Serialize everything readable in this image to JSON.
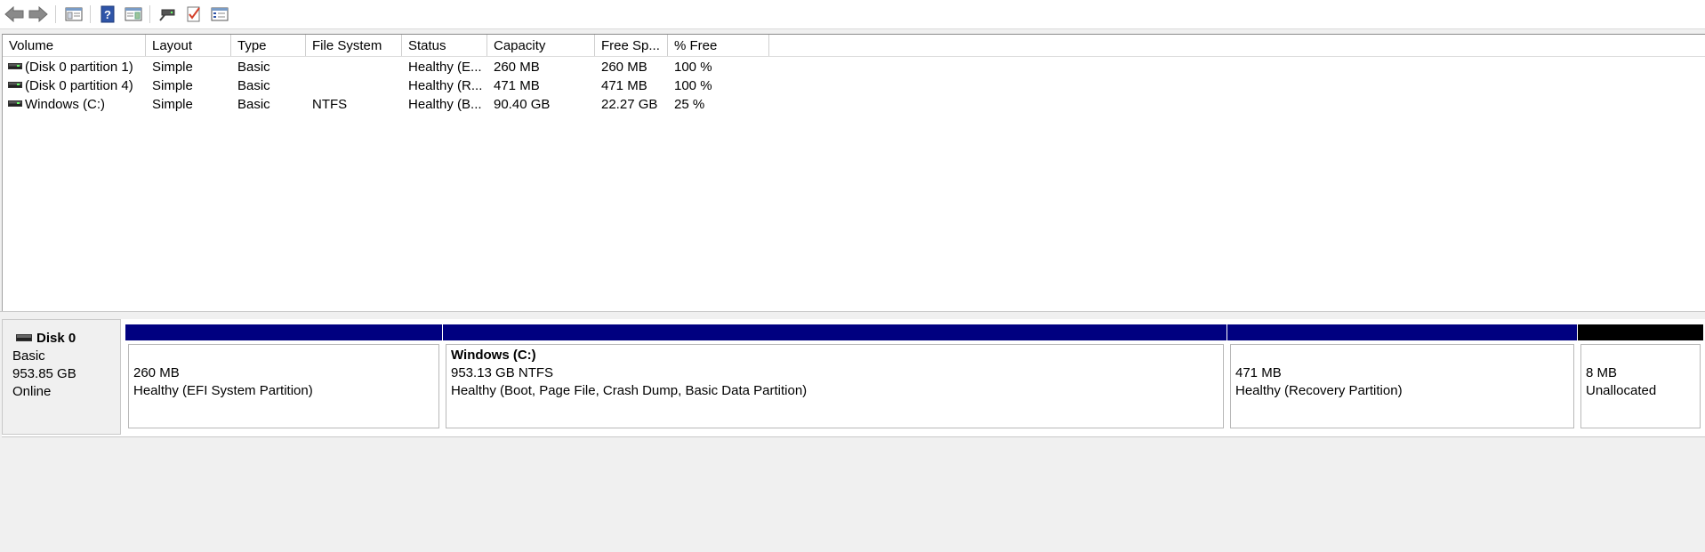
{
  "toolbar": {
    "buttons": [
      {
        "name": "back-arrow-icon"
      },
      {
        "name": "forward-arrow-icon"
      },
      {
        "name": "show-hide-console-tree-icon"
      },
      {
        "name": "help-icon"
      },
      {
        "name": "show-hide-action-pane-icon"
      },
      {
        "name": "connect-disk-icon"
      },
      {
        "name": "checklist-icon"
      },
      {
        "name": "properties-icon"
      }
    ]
  },
  "volume_list": {
    "columns": [
      "Volume",
      "Layout",
      "Type",
      "File System",
      "Status",
      "Capacity",
      "Free Sp...",
      "% Free"
    ],
    "rows": [
      {
        "volume": "(Disk 0 partition 1)",
        "layout": "Simple",
        "type": "Basic",
        "file_system": "",
        "status": "Healthy (E...",
        "capacity": "260 MB",
        "free_space": "260 MB",
        "percent_free": "100 %"
      },
      {
        "volume": "(Disk 0 partition 4)",
        "layout": "Simple",
        "type": "Basic",
        "file_system": "",
        "status": "Healthy (R...",
        "capacity": "471 MB",
        "free_space": "471 MB",
        "percent_free": "100 %"
      },
      {
        "volume": "Windows (C:)",
        "layout": "Simple",
        "type": "Basic",
        "file_system": "NTFS",
        "status": "Healthy (B...",
        "capacity": "90.40 GB",
        "free_space": "22.27 GB",
        "percent_free": "25 %"
      }
    ]
  },
  "disk": {
    "name": "Disk 0",
    "type": "Basic",
    "size": "953.85 GB",
    "status": "Online",
    "partitions": [
      {
        "title": "",
        "size": "260 MB",
        "status": "Healthy (EFI System Partition)",
        "bar_color": "#000080"
      },
      {
        "title": "Windows  (C:)",
        "size": "953.13 GB NTFS",
        "status": "Healthy (Boot, Page File, Crash Dump, Basic Data Partition)",
        "bar_color": "#000080"
      },
      {
        "title": "",
        "size": "471 MB",
        "status": "Healthy (Recovery Partition)",
        "bar_color": "#000080"
      },
      {
        "title": "",
        "size": "8 MB",
        "status": "Unallocated",
        "bar_color": "#000000"
      }
    ]
  }
}
